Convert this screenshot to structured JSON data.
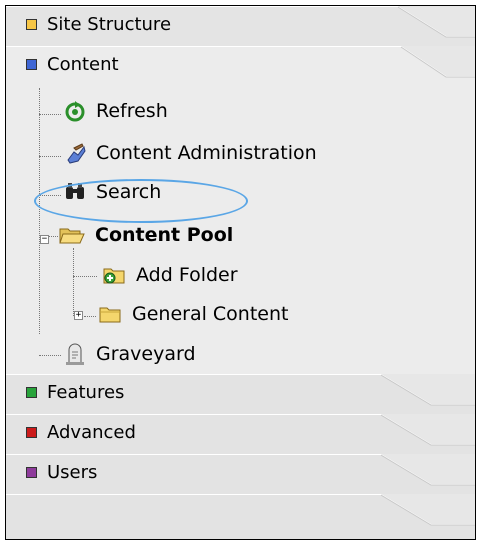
{
  "sections": [
    {
      "label": "Site Structure",
      "color": "#f7c646"
    },
    {
      "label": "Content",
      "color": "#3f66d4"
    },
    {
      "label": "Features",
      "color": "#28a33b"
    },
    {
      "label": "Advanced",
      "color": "#cc1b1b"
    },
    {
      "label": "Users",
      "color": "#8e3b9b"
    }
  ],
  "tree": {
    "refresh": "Refresh",
    "content_admin": "Content Administration",
    "search": "Search",
    "content_pool": "Content Pool",
    "add_folder": "Add Folder",
    "general_content": "General Content",
    "graveyard": "Graveyard"
  },
  "icons": {
    "refresh": "refresh-icon",
    "content_admin": "admin-hand-icon",
    "search": "binoculars-icon",
    "content_pool": "open-folder-icon",
    "add_folder": "add-folder-icon",
    "general_content": "folder-icon",
    "graveyard": "tombstone-icon"
  },
  "expanders": {
    "content_pool": "−",
    "general_content": "+"
  }
}
